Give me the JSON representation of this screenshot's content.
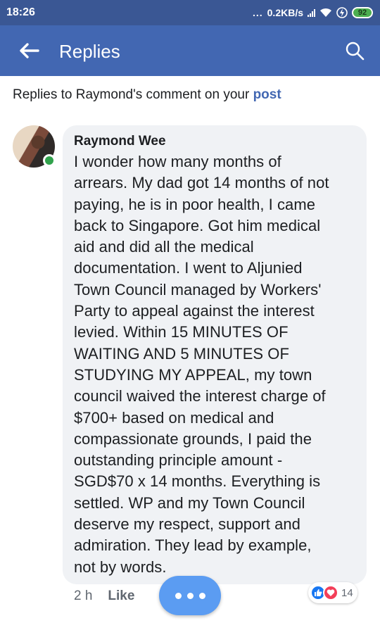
{
  "status_bar": {
    "time": "18:26",
    "dots": "...",
    "network_speed": "0.2KB/s",
    "battery": "92",
    "icons": [
      "signal-icon",
      "wifi-icon",
      "charging-icon",
      "battery-icon"
    ]
  },
  "app_bar": {
    "title": "Replies",
    "back_icon": "back-arrow-icon",
    "search_icon": "search-icon",
    "color": "#4267b2"
  },
  "context": {
    "prefix": "Replies to Raymond's comment on your ",
    "link": "post"
  },
  "comment": {
    "author": "Raymond Wee",
    "text": "I wonder how many months of\narrears. My dad got 14 months of not\npaying, he is in poor health, I came\nback to Singapore. Got him medical\naid and did all the medical\ndocumentation. I went to Aljunied\nTown Council managed by Workers'\nParty to appeal against the interest\nlevied. Within 15 MINUTES OF\nWAITING AND 5 MINUTES OF\nSTUDYING MY APPEAL, my town\ncouncil waived the interest charge of\n$700+ based on medical and\ncompassionate grounds, I paid the\noutstanding principle amount -\nSGD$70 x 14 months. Everything is\nsettled. WP and my Town Council\ndeserve my respect, support and\nadmiration. They lead by example,\nnot by words.",
    "online": true
  },
  "actions": {
    "time": "2 h",
    "like": "Like"
  },
  "reactions": {
    "count": "14",
    "types": [
      "like-reaction-icon",
      "love-reaction-icon"
    ]
  }
}
